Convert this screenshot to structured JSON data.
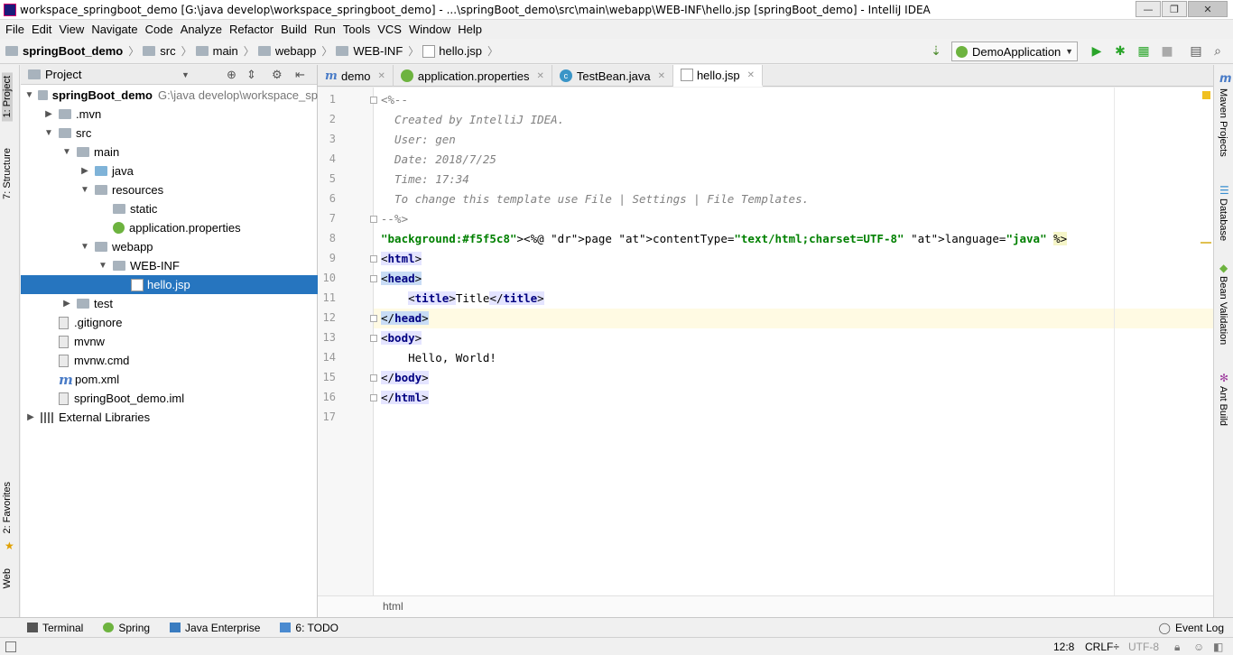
{
  "window": {
    "title": "workspace_springboot_demo [G:\\java develop\\workspace_springboot_demo] - ...\\springBoot_demo\\src\\main\\webapp\\WEB-INF\\hello.jsp [springBoot_demo] - IntelliJ IDEA",
    "minimize": "—",
    "restore": "❐",
    "close": "✕"
  },
  "menu": [
    "File",
    "Edit",
    "View",
    "Navigate",
    "Code",
    "Analyze",
    "Refactor",
    "Build",
    "Run",
    "Tools",
    "VCS",
    "Window",
    "Help"
  ],
  "breadcrumbs": [
    "springBoot_demo",
    "src",
    "main",
    "webapp",
    "WEB-INF",
    "hello.jsp"
  ],
  "run_config": {
    "label": "DemoApplication"
  },
  "left_tabs": [
    "1: Project",
    "7: Structure",
    "2: Favorites",
    "Web"
  ],
  "right_tabs": [
    "Maven Projects",
    "Database",
    "Bean Validation",
    "Ant Build"
  ],
  "project_panel": {
    "title": "Project"
  },
  "tree": [
    {
      "label": "springBoot_demo",
      "path": "G:\\java develop\\workspace_sp",
      "level": 0,
      "arrow": "▼",
      "icon": "folder",
      "bold": true
    },
    {
      "label": ".mvn",
      "level": 1,
      "arrow": "▶",
      "icon": "folder"
    },
    {
      "label": "src",
      "level": 1,
      "arrow": "▼",
      "icon": "folder"
    },
    {
      "label": "main",
      "level": 2,
      "arrow": "▼",
      "icon": "folder"
    },
    {
      "label": "java",
      "level": 3,
      "arrow": "▶",
      "icon": "folder-blue"
    },
    {
      "label": "resources",
      "level": 3,
      "arrow": "▼",
      "icon": "folder"
    },
    {
      "label": "static",
      "level": 4,
      "arrow": "",
      "icon": "folder"
    },
    {
      "label": "application.properties",
      "level": 4,
      "arrow": "",
      "icon": "spring"
    },
    {
      "label": "webapp",
      "level": 3,
      "arrow": "▼",
      "icon": "folder"
    },
    {
      "label": "WEB-INF",
      "level": 4,
      "arrow": "▼",
      "icon": "folder"
    },
    {
      "label": "hello.jsp",
      "level": 5,
      "arrow": "",
      "icon": "jsp",
      "selected": true
    },
    {
      "label": "test",
      "level": 2,
      "arrow": "▶",
      "icon": "folder"
    },
    {
      "label": ".gitignore",
      "level": 1,
      "arrow": "",
      "icon": "file"
    },
    {
      "label": "mvnw",
      "level": 1,
      "arrow": "",
      "icon": "file"
    },
    {
      "label": "mvnw.cmd",
      "level": 1,
      "arrow": "",
      "icon": "file"
    },
    {
      "label": "pom.xml",
      "level": 1,
      "arrow": "",
      "icon": "maven"
    },
    {
      "label": "springBoot_demo.iml",
      "level": 1,
      "arrow": "",
      "icon": "file"
    },
    {
      "label": "External Libraries",
      "level": 0,
      "arrow": "▶",
      "icon": "lib"
    }
  ],
  "editor_tabs": [
    {
      "label": "demo",
      "icon": "m",
      "color": "#4a7cc7"
    },
    {
      "label": "application.properties",
      "icon": "spring",
      "color": "#6db33f"
    },
    {
      "label": "TestBean.java",
      "icon": "c",
      "color": "#3a95c7"
    },
    {
      "label": "hello.jsp",
      "icon": "jsp",
      "color": "#c33",
      "active": true
    }
  ],
  "code_lines": [
    "<%--",
    "  Created by IntelliJ IDEA.",
    "  User: gen",
    "  Date: 2018/7/25",
    "  Time: 17:34",
    "  To change this template use File | Settings | File Templates.",
    "--%>",
    "<%@ page contentType=\"text/html;charset=UTF-8\" language=\"java\" %>",
    "<html>",
    "<head>",
    "    <title>Title</title>",
    "</head>",
    "<body>",
    "    Hello, World!",
    "</body>",
    "</html>",
    ""
  ],
  "editor_footer": "html",
  "bottom_tools": [
    "Terminal",
    "Spring",
    "Java Enterprise",
    "6: TODO"
  ],
  "event_log": "Event Log",
  "status": {
    "position": "12:8",
    "line_sep": "CRLF÷",
    "encoding": "UTF-8"
  }
}
